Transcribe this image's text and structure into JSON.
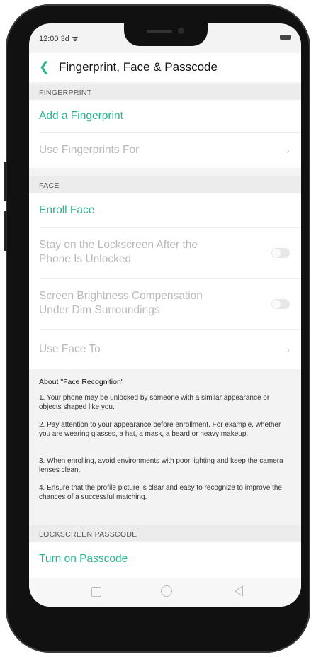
{
  "status": {
    "time": "12:00 3d ᯤ"
  },
  "header": {
    "title": "Fingerprint, Face & Passcode",
    "back_icon": "chevron-left-icon"
  },
  "sections": {
    "fingerprint": "FINGERPRINT",
    "face": "FACE",
    "passcode": "LOCKSCREEN PASSCODE"
  },
  "fingerprint": {
    "add_label": "Add a Fingerprint",
    "use_label": "Use Fingerprints For"
  },
  "face": {
    "enroll_label": "Enroll Face",
    "stay_line1": "Stay on the Lockscreen After the",
    "stay_line2": "Phone Is Unlocked",
    "stay_on": false,
    "brightness_line1": "Screen Brightness Compensation",
    "brightness_line2": "Under Dim Surroundings",
    "brightness_on": false,
    "use_label": "Use Face To"
  },
  "about": {
    "title": "About \"Face Recognition\"",
    "items": [
      "1. Your phone may be unlocked by someone with a similar appearance or objects shaped like you.",
      "2. Pay attention to your appearance before enrollment. For example, whether you are wearing glasses, a hat, a mask, a beard or heavy makeup.",
      "3. When enrolling, avoid environments with poor lighting and keep the camera lenses clean.",
      "4. Ensure that the profile picture is clear and easy to recognize to improve the chances of a successful matching."
    ]
  },
  "passcode": {
    "turn_on_label": "Turn on Passcode"
  },
  "colors": {
    "accent": "#2bb38d",
    "disabled": "#b9b9b9",
    "section_bg": "#ececec"
  }
}
